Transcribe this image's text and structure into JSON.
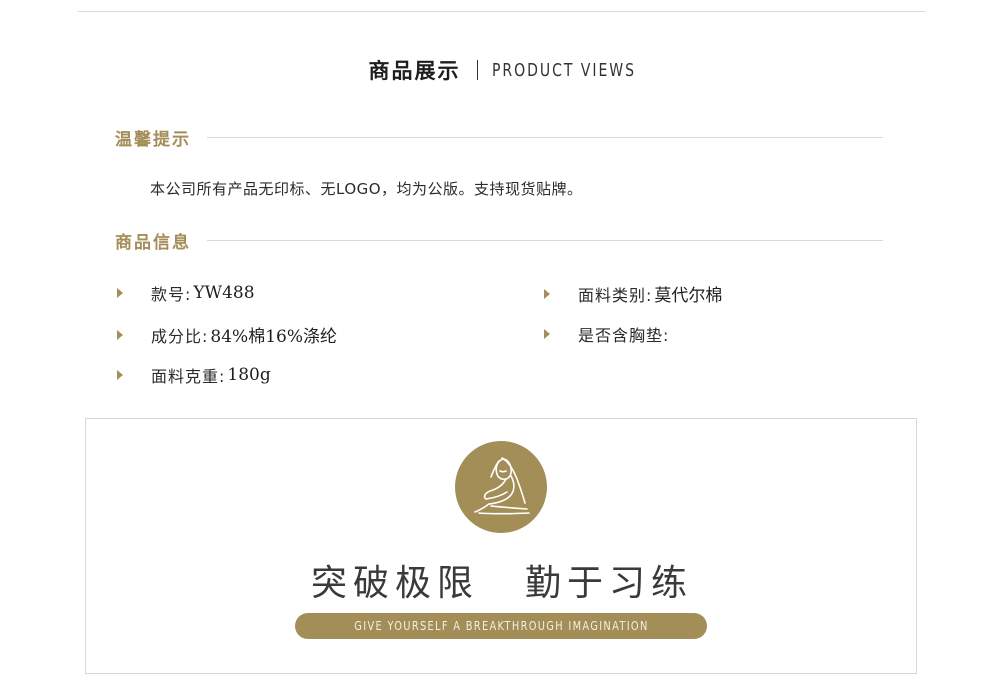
{
  "header": {
    "title_cn": "商品展示",
    "title_en": "PRODUCT VIEWS"
  },
  "notice_section": {
    "label": "温馨提示",
    "text": "本公司所有产品无印标、无LOGO，均为公版。支持现货贴牌。"
  },
  "info_section": {
    "label": "商品信息",
    "specs": [
      {
        "key": "款号:",
        "value": "YW488"
      },
      {
        "key": "面料类别:",
        "value": "莫代尔棉"
      },
      {
        "key": "成分比:",
        "value": "84%棉16%涤纶"
      },
      {
        "key": "是否含胸垫:",
        "value": ""
      },
      {
        "key": "面料克重:",
        "value": "180g"
      }
    ]
  },
  "banner": {
    "logo_icon": "yoga-figure-logo-icon",
    "slogan_left": "突破极限",
    "slogan_right": "勤于习练",
    "tagline": "GIVE YOURSELF A BREAKTHROUGH IMAGINATION"
  },
  "colors": {
    "accent_gold": "#a48e58",
    "text_dark": "#2b2b2b",
    "rule_gray": "#d9d9d9"
  }
}
